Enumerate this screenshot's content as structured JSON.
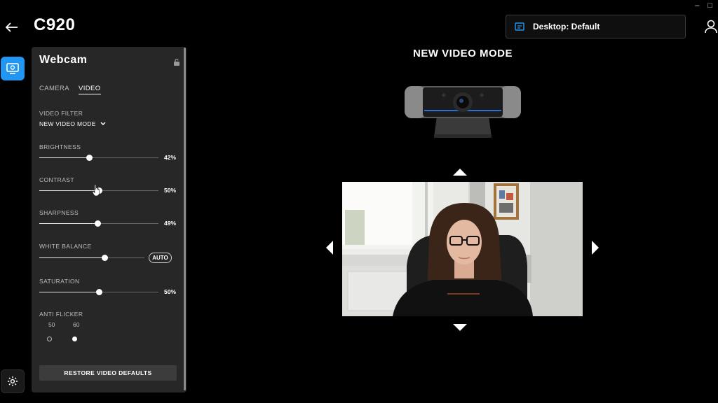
{
  "window": {
    "minimize": "–",
    "maximize": "□"
  },
  "header": {
    "title": "C920",
    "profile": "Desktop: Default"
  },
  "panel": {
    "title": "Webcam",
    "tabs": [
      {
        "label": "CAMERA",
        "active": false
      },
      {
        "label": "VIDEO",
        "active": true
      }
    ],
    "video_filter": {
      "label": "VIDEO FILTER",
      "value": "NEW VIDEO MODE"
    },
    "sliders": [
      {
        "label": "BRIGHTNESS",
        "value_text": "42%",
        "value": 0.42
      },
      {
        "label": "CONTRAST",
        "value_text": "50%",
        "value": 0.5
      },
      {
        "label": "SHARPNESS",
        "value_text": "49%",
        "value": 0.49
      },
      {
        "label": "WHITE BALANCE",
        "auto_label": "AUTO",
        "value": 0.62
      },
      {
        "label": "SATURATION",
        "value_text": "50%",
        "value": 0.5
      }
    ],
    "anti_flicker": {
      "label": "ANTI FLICKER",
      "options": [
        "50",
        "60"
      ],
      "selected": "60"
    },
    "restore_label": "RESTORE VIDEO DEFAULTS"
  },
  "main": {
    "heading": "NEW VIDEO MODE"
  },
  "colors": {
    "accent": "#2196f3",
    "panel": "#272727",
    "background": "#000000"
  }
}
